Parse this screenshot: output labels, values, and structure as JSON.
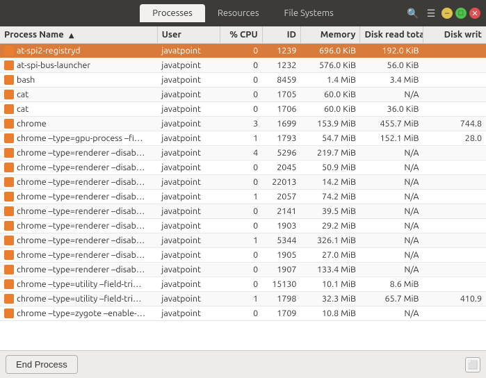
{
  "menubar": {
    "tabs": [
      {
        "label": "Processes",
        "active": true
      },
      {
        "label": "Resources",
        "active": false
      },
      {
        "label": "File Systems",
        "active": false
      }
    ],
    "search_icon": "🔍",
    "menu_icon": "☰",
    "win_min": "–",
    "win_max": "□",
    "win_close": "✕"
  },
  "table": {
    "columns": [
      {
        "label": "Process Name",
        "key": "name",
        "sort": "asc"
      },
      {
        "label": "User",
        "key": "user"
      },
      {
        "label": "% CPU",
        "key": "cpu"
      },
      {
        "label": "ID",
        "key": "id"
      },
      {
        "label": "Memory",
        "key": "memory"
      },
      {
        "label": "Disk read tota",
        "key": "disk_read"
      },
      {
        "label": "Disk writ",
        "key": "disk_write"
      }
    ],
    "rows": [
      {
        "name": "at-spi2-registryd",
        "user": "javatpoint",
        "cpu": "0",
        "id": "1239",
        "memory": "696.0 KiB",
        "disk_read": "192.0 KiB",
        "disk_write": "",
        "selected": true
      },
      {
        "name": "at-spi-bus-launcher",
        "user": "javatpoint",
        "cpu": "0",
        "id": "1232",
        "memory": "576.0 KiB",
        "disk_read": "56.0 KiB",
        "disk_write": ""
      },
      {
        "name": "bash",
        "user": "javatpoint",
        "cpu": "0",
        "id": "8459",
        "memory": "1.4 MiB",
        "disk_read": "3.4 MiB",
        "disk_write": ""
      },
      {
        "name": "cat",
        "user": "javatpoint",
        "cpu": "0",
        "id": "1705",
        "memory": "60.0 KiB",
        "disk_read": "N/A",
        "disk_write": ""
      },
      {
        "name": "cat",
        "user": "javatpoint",
        "cpu": "0",
        "id": "1706",
        "memory": "60.0 KiB",
        "disk_read": "36.0 KiB",
        "disk_write": ""
      },
      {
        "name": "chrome",
        "user": "javatpoint",
        "cpu": "3",
        "id": "1699",
        "memory": "153.9 MiB",
        "disk_read": "455.7 MiB",
        "disk_write": "744.8"
      },
      {
        "name": "chrome –type=gpu-process –fi…",
        "user": "javatpoint",
        "cpu": "1",
        "id": "1793",
        "memory": "54.7 MiB",
        "disk_read": "152.1 MiB",
        "disk_write": "28.0"
      },
      {
        "name": "chrome –type=renderer –disab…",
        "user": "javatpoint",
        "cpu": "4",
        "id": "5296",
        "memory": "219.7 MiB",
        "disk_read": "N/A",
        "disk_write": ""
      },
      {
        "name": "chrome –type=renderer –disab…",
        "user": "javatpoint",
        "cpu": "0",
        "id": "2045",
        "memory": "50.9 MiB",
        "disk_read": "N/A",
        "disk_write": ""
      },
      {
        "name": "chrome –type=renderer –disab…",
        "user": "javatpoint",
        "cpu": "0",
        "id": "22013",
        "memory": "14.2 MiB",
        "disk_read": "N/A",
        "disk_write": ""
      },
      {
        "name": "chrome –type=renderer –disab…",
        "user": "javatpoint",
        "cpu": "1",
        "id": "2057",
        "memory": "74.2 MiB",
        "disk_read": "N/A",
        "disk_write": ""
      },
      {
        "name": "chrome –type=renderer –disab…",
        "user": "javatpoint",
        "cpu": "0",
        "id": "2141",
        "memory": "39.5 MiB",
        "disk_read": "N/A",
        "disk_write": ""
      },
      {
        "name": "chrome –type=renderer –disab…",
        "user": "javatpoint",
        "cpu": "0",
        "id": "1903",
        "memory": "29.2 MiB",
        "disk_read": "N/A",
        "disk_write": ""
      },
      {
        "name": "chrome –type=renderer –disab…",
        "user": "javatpoint",
        "cpu": "1",
        "id": "5344",
        "memory": "326.1 MiB",
        "disk_read": "N/A",
        "disk_write": ""
      },
      {
        "name": "chrome –type=renderer –disab…",
        "user": "javatpoint",
        "cpu": "0",
        "id": "1905",
        "memory": "27.0 MiB",
        "disk_read": "N/A",
        "disk_write": ""
      },
      {
        "name": "chrome –type=renderer –disab…",
        "user": "javatpoint",
        "cpu": "0",
        "id": "1907",
        "memory": "133.4 MiB",
        "disk_read": "N/A",
        "disk_write": ""
      },
      {
        "name": "chrome –type=utility –field-tri…",
        "user": "javatpoint",
        "cpu": "0",
        "id": "15130",
        "memory": "10.1 MiB",
        "disk_read": "8.6 MiB",
        "disk_write": ""
      },
      {
        "name": "chrome –type=utility –field-tri…",
        "user": "javatpoint",
        "cpu": "1",
        "id": "1798",
        "memory": "32.3 MiB",
        "disk_read": "65.7 MiB",
        "disk_write": "410.9"
      },
      {
        "name": "chrome –type=zygote –enable-…",
        "user": "javatpoint",
        "cpu": "0",
        "id": "1709",
        "memory": "10.8 MiB",
        "disk_read": "N/A",
        "disk_write": ""
      }
    ]
  },
  "bottombar": {
    "end_process_label": "End Process",
    "status_icon": "⬜"
  }
}
